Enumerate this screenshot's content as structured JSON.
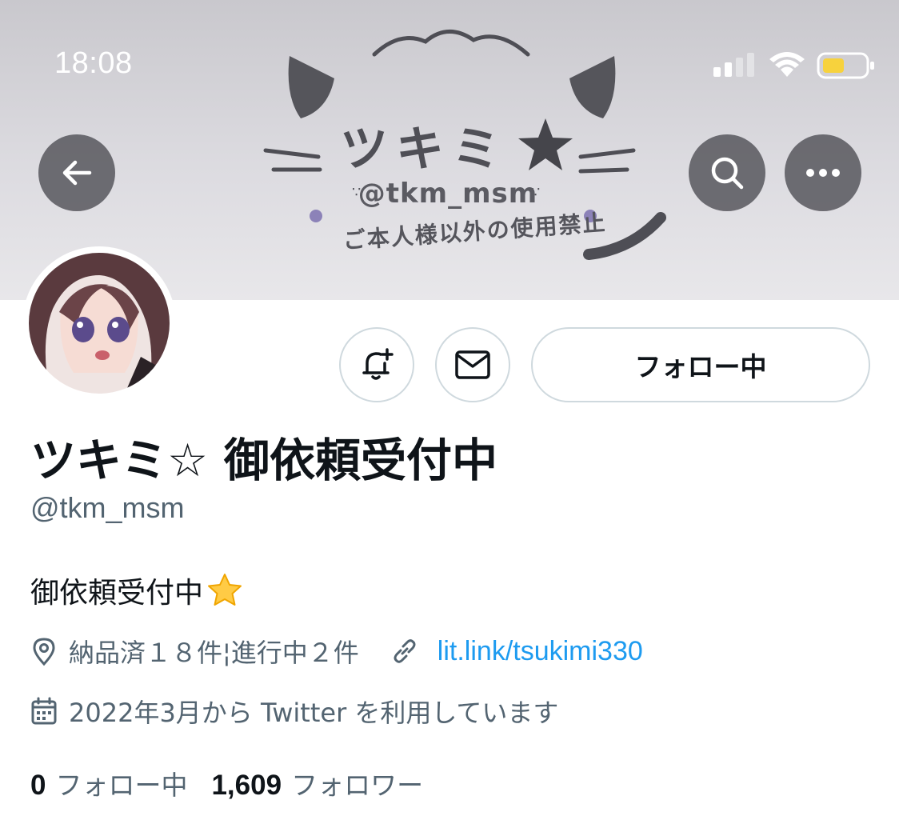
{
  "status_bar": {
    "time": "18:08"
  },
  "banner": {
    "title": "ツキミ",
    "handle": "@tkm_msm",
    "notice": "ご本人様以外の使用禁止"
  },
  "profile": {
    "display_name": "ツキミ☆ 御依頼受付中",
    "handle": "@tkm_msm",
    "bio": "御依頼受付中",
    "bio_emoji": "star-emoji",
    "location": "納品済１８件¦進行中２件",
    "link": "lit.link/tsukimi330",
    "joined": "2022年3月から Twitter を利用しています",
    "following_count": "0",
    "following_label": "フォロー中",
    "followers_count": "1,609",
    "followers_label": "フォロワー"
  },
  "actions": {
    "follow_button_label": "フォロー中"
  },
  "colors": {
    "accent": "#1d9bf0",
    "text_primary": "#0f1419",
    "text_secondary": "#536471",
    "border": "#cfd9de",
    "battery": "#f7d23d"
  }
}
